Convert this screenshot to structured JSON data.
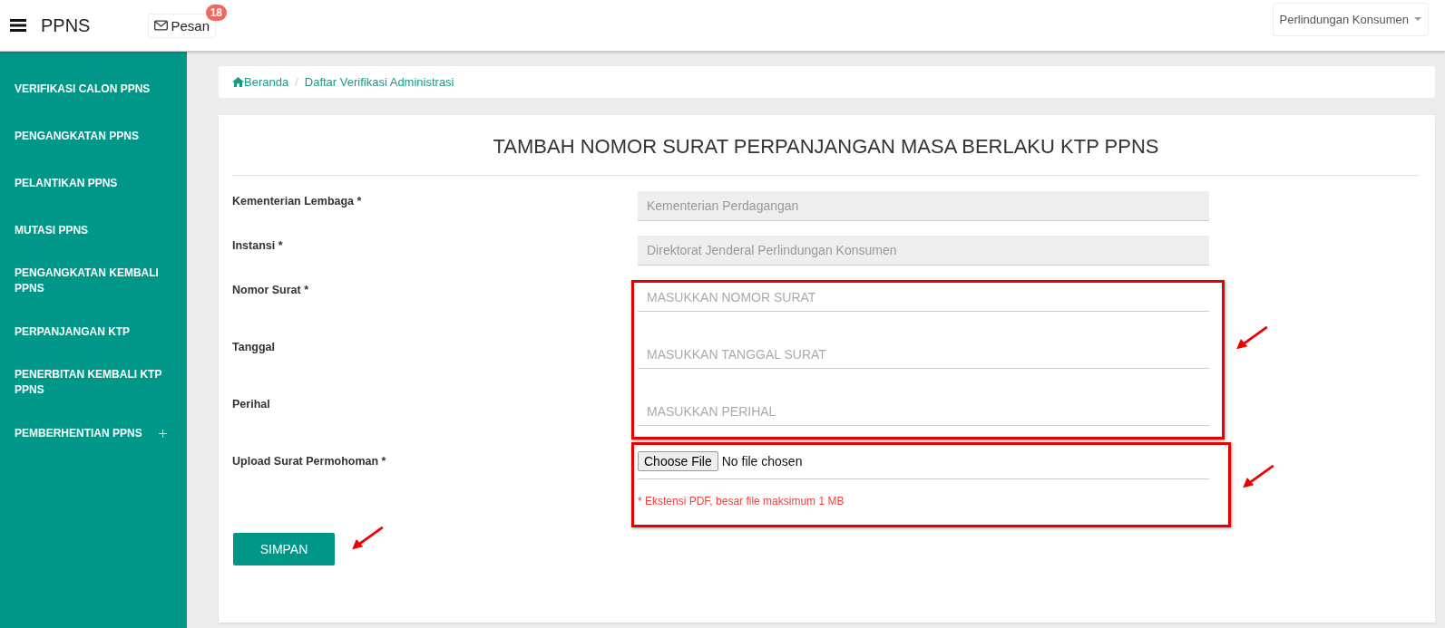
{
  "header": {
    "brand": "PPNS",
    "messages": {
      "label": "Pesan",
      "badge": "18"
    },
    "user_menu": "Perlindungan Konsumen"
  },
  "sidebar": {
    "items": [
      {
        "label": "VERIFIKASI CALON PPNS",
        "expandable": false
      },
      {
        "label": "PENGANGKATAN PPNS",
        "expandable": false
      },
      {
        "label": "PELANTIKAN PPNS",
        "expandable": false
      },
      {
        "label": "MUTASI PPNS",
        "expandable": false
      },
      {
        "label": "PENGANGKATAN KEMBALI PPNS",
        "expandable": false
      },
      {
        "label": "PERPANJANGAN KTP",
        "expandable": false
      },
      {
        "label": "PENERBITAN KEMBALI KTP PPNS",
        "expandable": false
      },
      {
        "label": "PEMBERHENTIAN PPNS",
        "expandable": true
      }
    ]
  },
  "breadcrumb": {
    "items": [
      "Beranda",
      "Daftar Verifikasi Administrasi"
    ],
    "separator": "/"
  },
  "form": {
    "title": "TAMBAH NOMOR SURAT PERPANJANGAN MASA BERLAKU KTP PPNS",
    "fields": [
      {
        "kind": "text",
        "label": "Kementerian Lembaga *",
        "value": "Kementerian Perdagangan",
        "disabled": true
      },
      {
        "kind": "text",
        "label": "Instansi *",
        "value": "Direktorat Jenderal Perlindungan Konsumen",
        "disabled": true
      }
    ],
    "highlighted_fields": [
      {
        "kind": "text",
        "label": "Nomor Surat *",
        "placeholder": "MASUKKAN NOMOR SURAT",
        "disabled": false
      },
      {
        "kind": "text",
        "label": "Tanggal",
        "placeholder": "MASUKKAN TANGGAL SURAT",
        "disabled": false
      },
      {
        "kind": "text",
        "label": "Perihal",
        "placeholder": "MASUKKAN PERIHAL",
        "disabled": false
      }
    ],
    "upload": {
      "kind": "file",
      "label": "Upload Surat Permohoman *",
      "button": "Choose File",
      "status": "No file chosen",
      "hint": "* Ekstensi PDF, besar file maksimum 1 MB"
    },
    "submit": "SIMPAN"
  }
}
